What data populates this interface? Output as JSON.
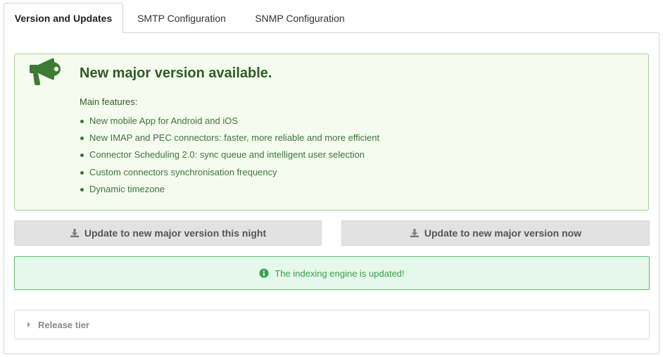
{
  "tabs": [
    {
      "label": "Version and Updates",
      "active": true
    },
    {
      "label": "SMTP Configuration",
      "active": false
    },
    {
      "label": "SNMP Configuration",
      "active": false
    }
  ],
  "announcement": {
    "icon": "megaphone-icon",
    "title": "New major version available.",
    "features_label": "Main features:",
    "features": [
      "New mobile App for Android and iOS",
      "New IMAP and PEC connectors: faster, more reliable and more efficient",
      "Connector Scheduling 2.0: sync queue and intelligent user selection",
      "Custom connectors synchronisation frequency",
      "Dynamic timezone"
    ]
  },
  "buttons": {
    "update_night": "Update to new major version this night",
    "update_now": "Update to new major version now",
    "icon": "download-icon"
  },
  "status": {
    "icon": "info-circle-icon",
    "message": "The indexing engine is updated!"
  },
  "release_tier": {
    "label": "Release tier",
    "expanded": false
  },
  "colors": {
    "announce_bg": "#f5fbef",
    "announce_border": "#a9cf96",
    "announce_text": "#3c763d",
    "success_bg": "#e5f8ea",
    "success_border": "#5fb870",
    "success_text": "#3aa04d",
    "button_bg": "#e2e2e2"
  }
}
